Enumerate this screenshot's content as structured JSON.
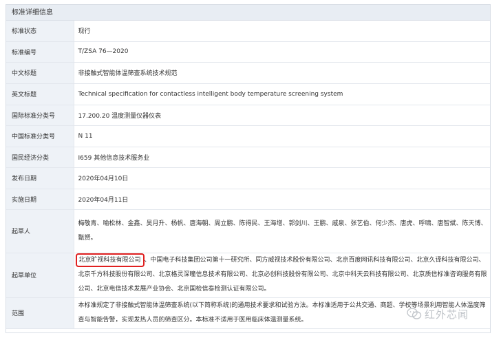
{
  "section_title": "标准详细信息",
  "rows": [
    {
      "label": "标准状态",
      "value": "现行"
    },
    {
      "label": "标准编号",
      "value": "T/ZSA 76—2020"
    },
    {
      "label": "中文标题",
      "value": "非接触式智能体温筛查系统技术规范"
    },
    {
      "label": "英文标题",
      "value": "Technical specification for contactless intelligent body temperature screening system"
    },
    {
      "label": "国际标准分类号",
      "value": "17.200.20 温度测量仪器仪表"
    },
    {
      "label": "中国标准分类号",
      "value": "N 11"
    },
    {
      "label": "国民经济分类",
      "value": "I659 其他信息技术服务业"
    },
    {
      "label": "发布日期",
      "value": "2020年04月10日"
    },
    {
      "label": "实施日期",
      "value": "2020年04月11日"
    },
    {
      "label": "起草人",
      "value": "梅敬青、喻松林、金鑫、吴月升、杨帆、唐海朝、周立鹏、陈得民、王海增、郭剑川、王鹏、戚泉、张艺伯、何少杰、唐虎、呼啸、唐智斌、陈天博、甄赟。"
    },
    {
      "label": "起草单位",
      "highlight": "北京旷视科技有限公司",
      "value": "、中国电子科技集团公司第十一研究所、同方威视技术股份有限公司、北京百度网讯科技有限公司、北京久译科技有限公司、北京千方科技股份有限公司、北京格灵深瞳信息技术有限公司、北京必创科技股份有限公司、北京中科天云科技有限公司、北京质信标准咨询服务有限公司、北京电信技术发展产业协会、北京国检信泰检测认证有限公司。"
    },
    {
      "label": "范围",
      "value": "本标准规定了非接触式智能体温筛查系统(以下简称系统)的通用技术要求和试验方法。本标准适用于公共交通、商超、学校等场景利用智能人体温度筛查与智能告警，实现发热人员的筛查区分。本标准不适用于医用临床体温测量系统。"
    }
  ],
  "watermark": {
    "text": "红外芯闻",
    "icon": "wechat-icon"
  }
}
